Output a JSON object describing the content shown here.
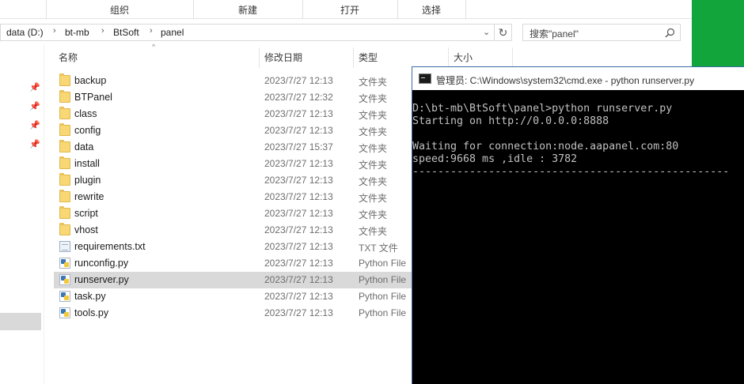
{
  "ribbon": {
    "groups": [
      "组织",
      "新建",
      "打开",
      "选择"
    ]
  },
  "address": {
    "crumbs": [
      "data (D:)",
      "bt-mb",
      "BtSoft",
      "panel"
    ],
    "search_placeholder": "搜索\"panel\""
  },
  "columns": {
    "name": "名称",
    "date": "修改日期",
    "type": "类型",
    "size": "大小"
  },
  "files": [
    {
      "name": "backup",
      "date": "2023/7/27 12:13",
      "type": "文件夹",
      "icon": "folder-icon"
    },
    {
      "name": "BTPanel",
      "date": "2023/7/27 12:32",
      "type": "文件夹",
      "icon": "folder-icon"
    },
    {
      "name": "class",
      "date": "2023/7/27 12:13",
      "type": "文件夹",
      "icon": "folder-icon"
    },
    {
      "name": "config",
      "date": "2023/7/27 12:13",
      "type": "文件夹",
      "icon": "folder-icon"
    },
    {
      "name": "data",
      "date": "2023/7/27 15:37",
      "type": "文件夹",
      "icon": "folder-icon"
    },
    {
      "name": "install",
      "date": "2023/7/27 12:13",
      "type": "文件夹",
      "icon": "folder-icon"
    },
    {
      "name": "plugin",
      "date": "2023/7/27 12:13",
      "type": "文件夹",
      "icon": "folder-icon"
    },
    {
      "name": "rewrite",
      "date": "2023/7/27 12:13",
      "type": "文件夹",
      "icon": "folder-icon"
    },
    {
      "name": "script",
      "date": "2023/7/27 12:13",
      "type": "文件夹",
      "icon": "folder-icon"
    },
    {
      "name": "vhost",
      "date": "2023/7/27 12:13",
      "type": "文件夹",
      "icon": "folder-icon"
    },
    {
      "name": "requirements.txt",
      "date": "2023/7/27 12:13",
      "type": "TXT 文件",
      "icon": "text-file-icon"
    },
    {
      "name": "runconfig.py",
      "date": "2023/7/27 12:13",
      "type": "Python File",
      "icon": "python-file-icon"
    },
    {
      "name": "runserver.py",
      "date": "2023/7/27 12:13",
      "type": "Python File",
      "icon": "python-file-icon",
      "selected": true
    },
    {
      "name": "task.py",
      "date": "2023/7/27 12:13",
      "type": "Python File",
      "icon": "python-file-icon"
    },
    {
      "name": "tools.py",
      "date": "2023/7/27 12:13",
      "type": "Python File",
      "icon": "python-file-icon"
    }
  ],
  "cmd": {
    "title": "管理员: C:\\Windows\\system32\\cmd.exe - python  runserver.py",
    "lines": [
      "D:\\bt-mb\\BtSoft\\panel>python runserver.py",
      "Starting on http://0.0.0.0:8888",
      "",
      "Waiting for connection:node.aapanel.com:80",
      "speed:9668 ms ,idle : 3782",
      "--------------------------------------------------"
    ]
  },
  "colors": {
    "desktop_green": "#12a53b",
    "selection_gray": "#d9d9d9",
    "console_bg": "#000000",
    "console_text": "#c0c0c0"
  }
}
